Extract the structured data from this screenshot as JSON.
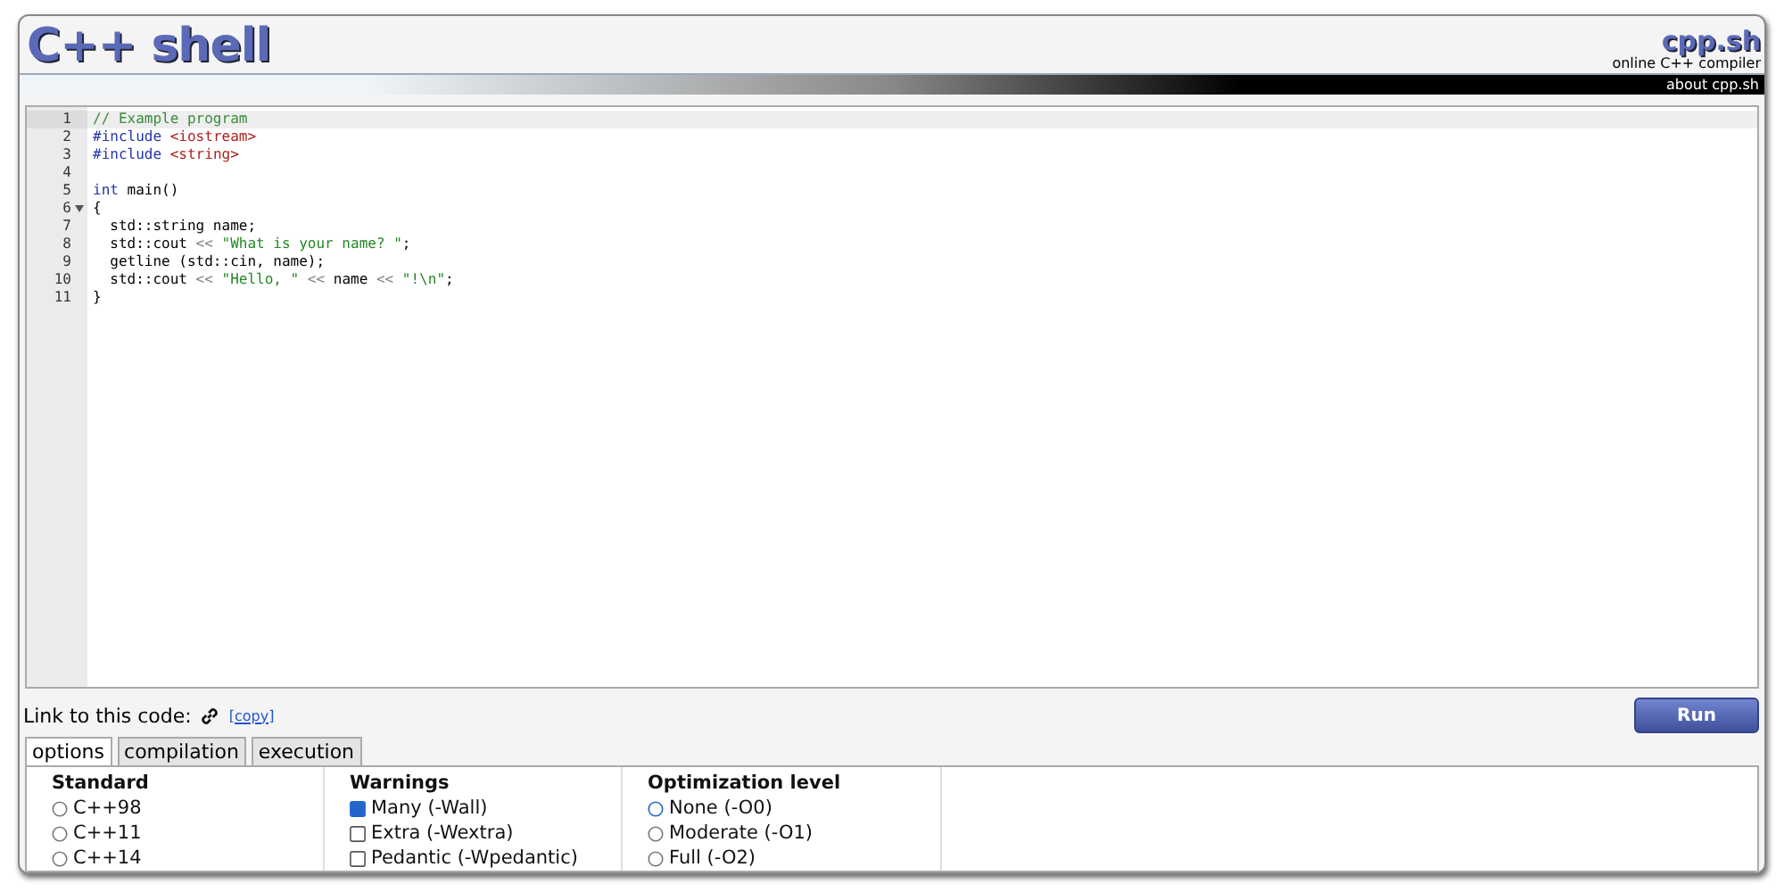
{
  "header": {
    "title": "C++ shell",
    "site": "cpp.sh",
    "tagline": "online C++ compiler",
    "about_link": "about cpp.sh"
  },
  "editor": {
    "lines": [
      {
        "number": "1",
        "active": true,
        "segments": [
          {
            "kind": "comment",
            "text": "// Example program"
          }
        ]
      },
      {
        "number": "2",
        "active": false,
        "segments": [
          {
            "kind": "preproc",
            "text": "#include "
          },
          {
            "kind": "header",
            "text": "<iostream>"
          }
        ]
      },
      {
        "number": "3",
        "active": false,
        "segments": [
          {
            "kind": "preproc",
            "text": "#include "
          },
          {
            "kind": "header",
            "text": "<string>"
          }
        ]
      },
      {
        "number": "4",
        "active": false
      },
      {
        "number": "5",
        "active": false,
        "segments": [
          {
            "kind": "keyword",
            "text": "int"
          },
          {
            "kind": "plain",
            "text": " main()"
          }
        ]
      },
      {
        "number": "6",
        "active": false,
        "fold": true,
        "segments": [
          {
            "kind": "plain",
            "text": "{"
          }
        ]
      },
      {
        "number": "7",
        "active": false,
        "segments": [
          {
            "kind": "plain",
            "text": "  std::string name;"
          }
        ]
      },
      {
        "number": "8",
        "active": false,
        "segments": [
          {
            "kind": "plain",
            "text": "  std::cout "
          },
          {
            "kind": "operator",
            "text": "<<"
          },
          {
            "kind": "string",
            "text": " \"What is your name? \""
          },
          {
            "kind": "plain",
            "text": ";"
          }
        ]
      },
      {
        "number": "9",
        "active": false,
        "segments": [
          {
            "kind": "plain",
            "text": "  getline (std::cin, name);"
          }
        ]
      },
      {
        "number": "10",
        "active": false,
        "segments": [
          {
            "kind": "plain",
            "text": "  std::cout "
          },
          {
            "kind": "operator",
            "text": "<<"
          },
          {
            "kind": "string",
            "text": " \"Hello, \""
          },
          {
            "kind": "operator",
            "text": " <<"
          },
          {
            "kind": "plain",
            "text": " name "
          },
          {
            "kind": "operator",
            "text": "<<"
          },
          {
            "kind": "string",
            "text": " \"!\\n\""
          },
          {
            "kind": "plain",
            "text": ";"
          }
        ]
      },
      {
        "number": "11",
        "active": false,
        "segments": [
          {
            "kind": "plain",
            "text": "}"
          }
        ]
      }
    ]
  },
  "link_row": {
    "label": "Link to this code:",
    "copy_link": "[copy]"
  },
  "run_button": "Run",
  "tabs": [
    {
      "label": "options",
      "selected": true
    },
    {
      "label": "compilation",
      "selected": false
    },
    {
      "label": "execution",
      "selected": false
    }
  ],
  "option_groups": [
    {
      "title": "Standard",
      "items": [
        {
          "kind": "radio",
          "label": "C++98",
          "checked": false
        },
        {
          "kind": "radio",
          "label": "C++11",
          "checked": false
        },
        {
          "kind": "radio",
          "label": "C++14",
          "checked": false
        }
      ]
    },
    {
      "title": "Warnings",
      "items": [
        {
          "kind": "checkbox",
          "label": "Many (-Wall)",
          "checked": true
        },
        {
          "kind": "checkbox",
          "label": "Extra (-Wextra)",
          "checked": false
        },
        {
          "kind": "checkbox",
          "label": "Pedantic (-Wpedantic)",
          "checked": false
        }
      ]
    },
    {
      "title": "Optimization level",
      "items": [
        {
          "kind": "radio",
          "label": "None (-O0)",
          "checked": true
        },
        {
          "kind": "radio",
          "label": "Moderate (-O1)",
          "checked": false
        },
        {
          "kind": "radio",
          "label": "Full (-O2)",
          "checked": false
        }
      ]
    }
  ]
}
